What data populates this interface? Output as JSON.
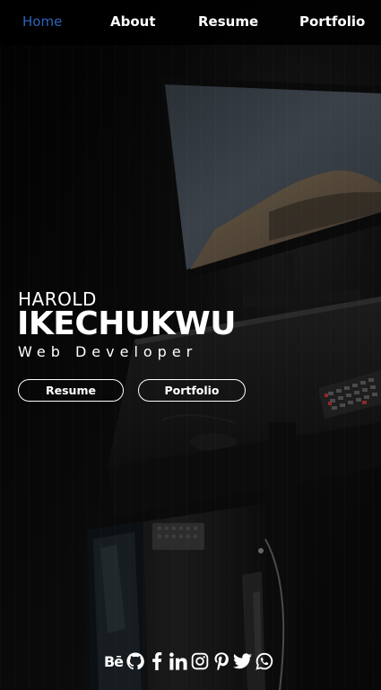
{
  "nav": {
    "items": [
      {
        "label": "Home",
        "active": true
      },
      {
        "label": "About",
        "active": false
      },
      {
        "label": "Resume",
        "active": false
      },
      {
        "label": "Portfolio",
        "active": false
      }
    ],
    "active_color": "#2f62b8"
  },
  "hero": {
    "first_name": "HAROLD",
    "last_name": "IKECHUKWU",
    "role": "Web Developer",
    "buttons": {
      "resume_label": "Resume",
      "portfolio_label": "Portfolio"
    }
  },
  "social": {
    "behance_label": "Bē",
    "icons": [
      "behance-icon",
      "github-icon",
      "facebook-icon",
      "linkedin-icon",
      "instagram-icon",
      "pinterest-icon",
      "twitter-icon",
      "whatsapp-icon"
    ]
  }
}
